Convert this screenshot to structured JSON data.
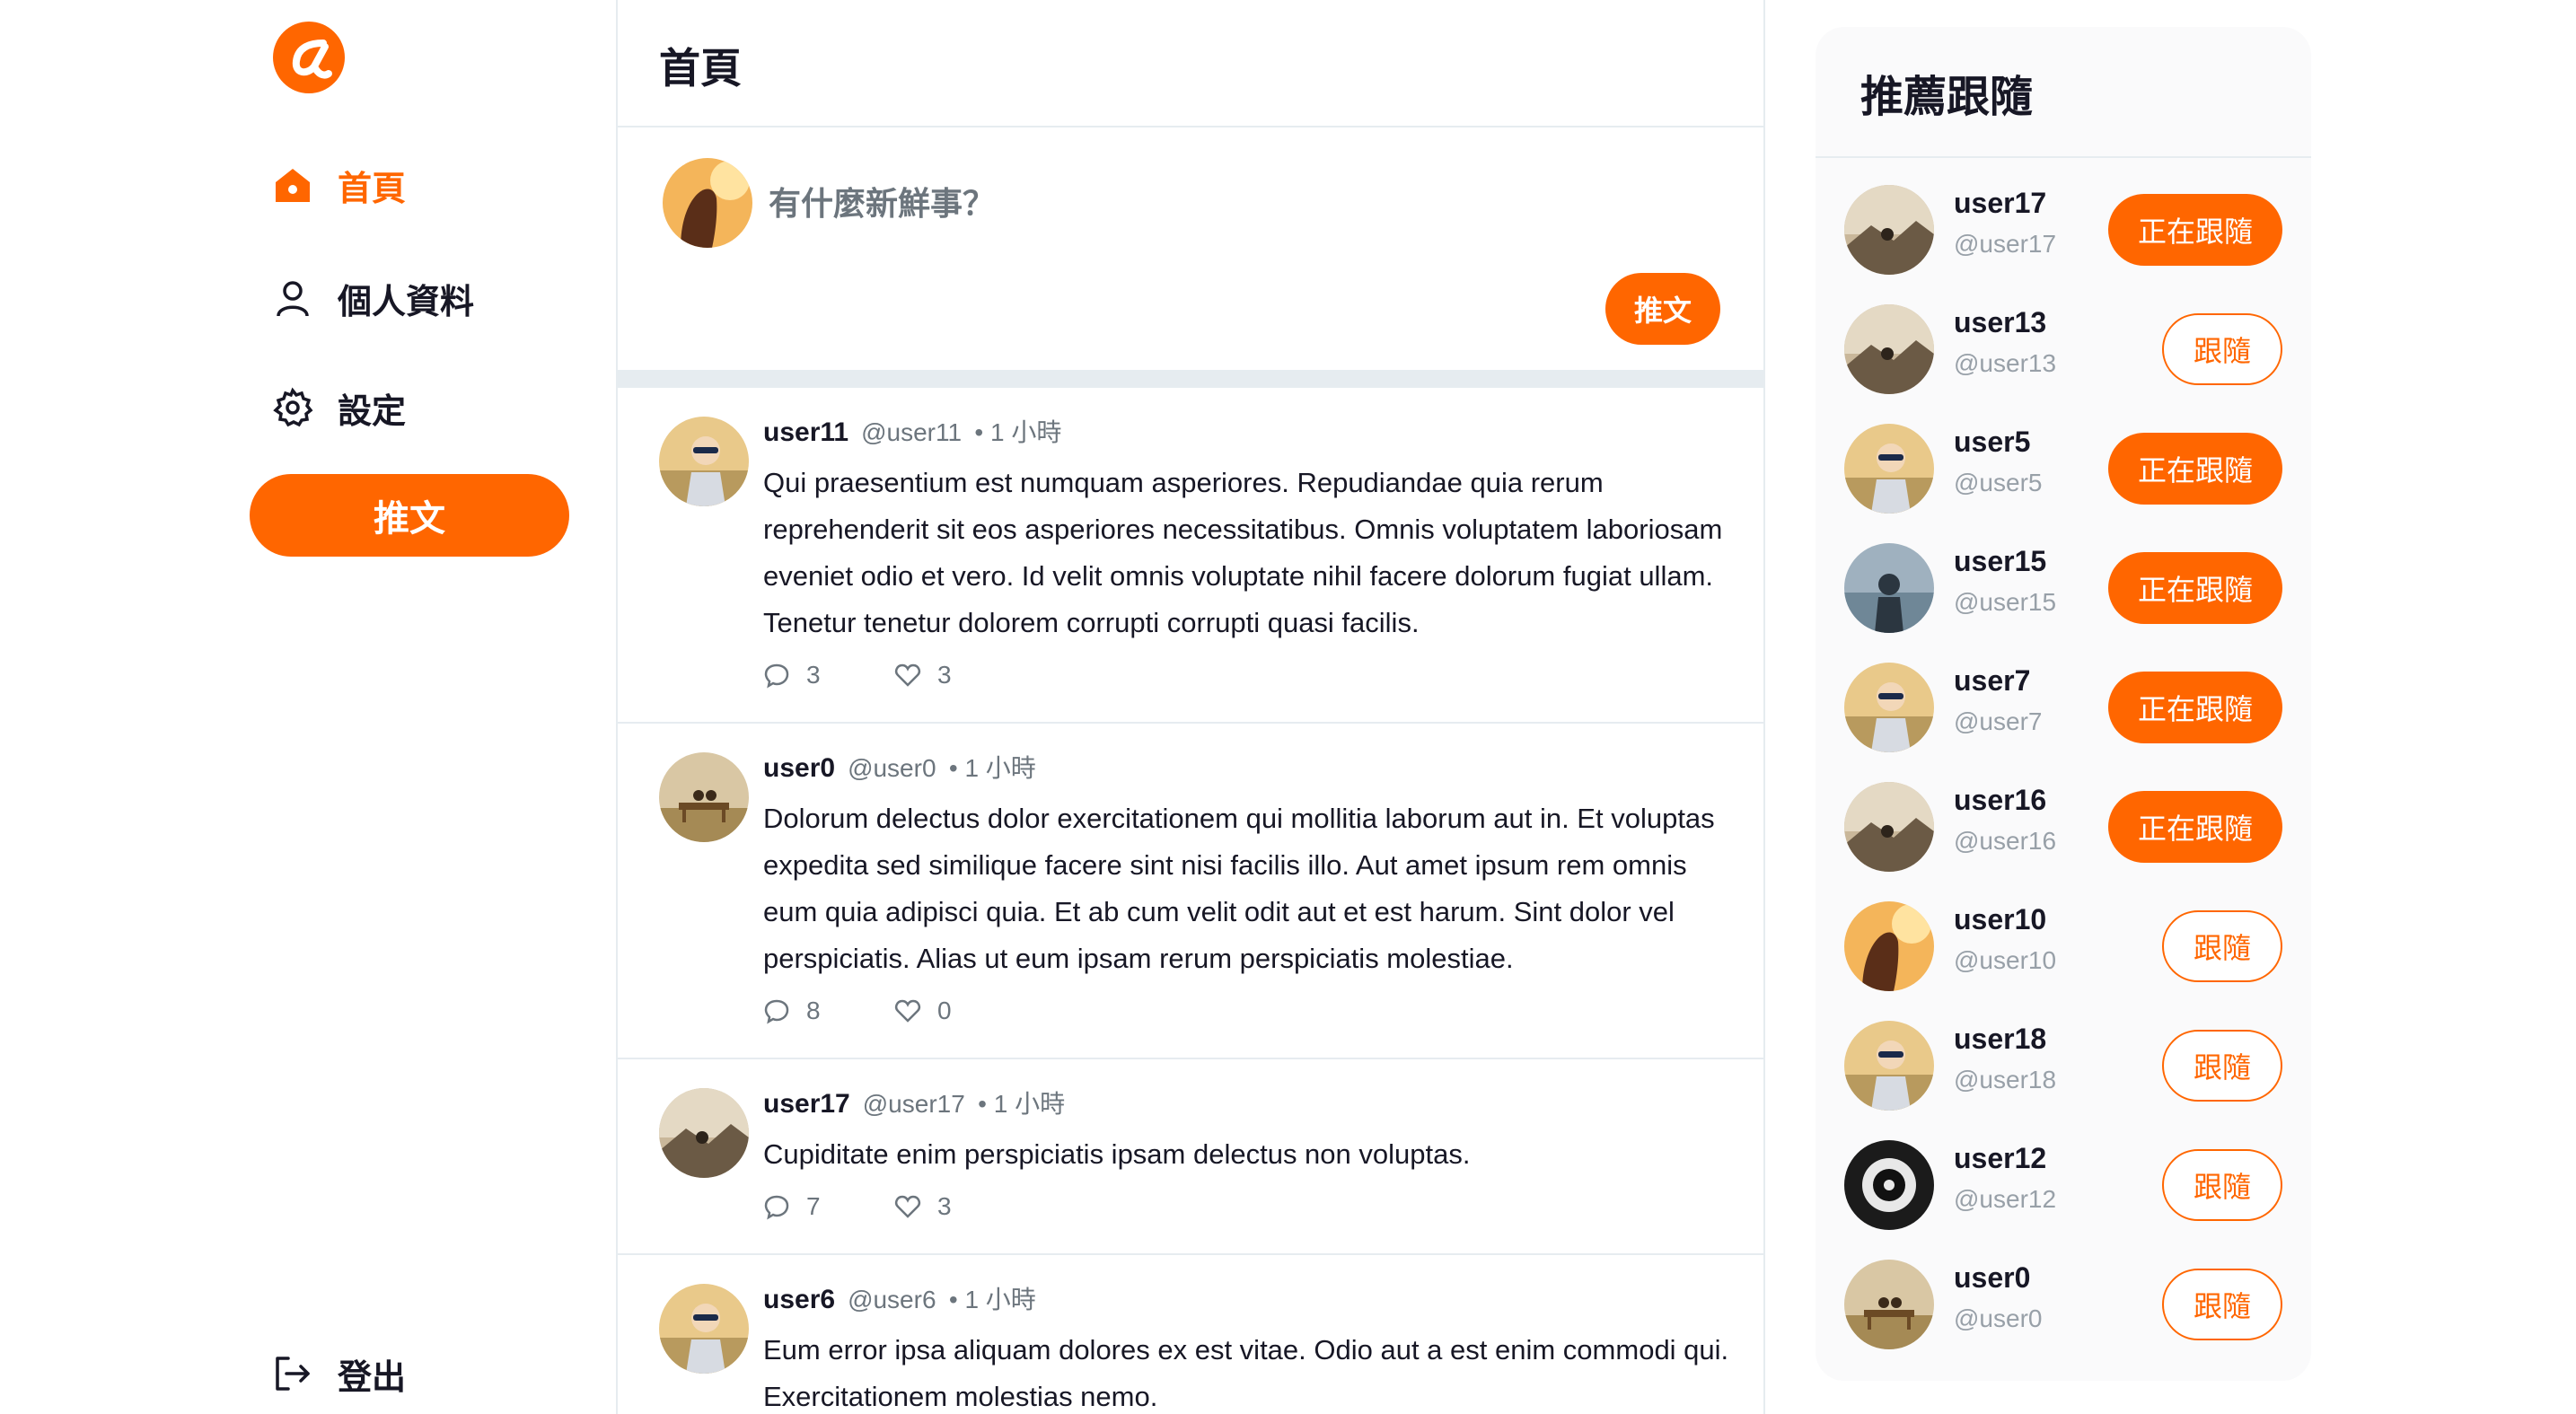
{
  "brand": {
    "accent": "#ff6600",
    "text": "#171725",
    "muted": "#6c757d",
    "logo_icon": "alpha-logo-icon"
  },
  "sidebar": {
    "nav": [
      {
        "label": "首頁",
        "icon": "home-icon",
        "active": true
      },
      {
        "label": "個人資料",
        "icon": "user-icon",
        "active": false
      },
      {
        "label": "設定",
        "icon": "gear-icon",
        "active": false
      }
    ],
    "tweet_button": "推文",
    "logout": {
      "label": "登出",
      "icon": "logout-icon"
    }
  },
  "main": {
    "title": "首頁",
    "compose": {
      "placeholder": "有什麼新鮮事？",
      "button": "推文"
    },
    "tweets": [
      {
        "name": "user11",
        "handle": "@user11",
        "time": "• 1 小時",
        "body": "Qui praesentium est numquam asperiores. Repudiandae quia rerum reprehenderit sit eos asperiores necessitatibus. Omnis voluptatem laboriosam eveniet odio et vero. Id velit omnis voluptate nihil facere dolorum fugiat ullam. Tenetur tenetur dolorem corrupti corrupti quasi facilis.",
        "replies": "3",
        "likes": "3"
      },
      {
        "name": "user0",
        "handle": "@user0",
        "time": "• 1 小時",
        "body": "Dolorum delectus dolor exercitationem qui mollitia laborum aut in. Et voluptas expedita sed similique facere sint nisi facilis illo. Aut amet ipsum rem omnis eum quia adipisci quia. Et ab cum velit odit aut et est harum. Sint dolor vel perspiciatis. Alias ut eum ipsam rerum perspiciatis molestiae.",
        "replies": "8",
        "likes": "0"
      },
      {
        "name": "user17",
        "handle": "@user17",
        "time": "• 1 小時",
        "body": "Cupiditate enim perspiciatis ipsam delectus non voluptas.",
        "replies": "7",
        "likes": "3"
      },
      {
        "name": "user6",
        "handle": "@user6",
        "time": "• 1 小時",
        "body": "Eum error ipsa aliquam dolores ex est vitae. Odio aut a est enim commodi qui. Exercitationem molestias nemo.",
        "replies": "",
        "likes": ""
      }
    ]
  },
  "recommend": {
    "title": "推薦跟隨",
    "users": [
      {
        "name": "user17",
        "handle": "@user17",
        "button": "正在跟隨",
        "following": true
      },
      {
        "name": "user13",
        "handle": "@user13",
        "button": "跟隨",
        "following": false
      },
      {
        "name": "user5",
        "handle": "@user5",
        "button": "正在跟隨",
        "following": true
      },
      {
        "name": "user15",
        "handle": "@user15",
        "button": "正在跟隨",
        "following": true
      },
      {
        "name": "user7",
        "handle": "@user7",
        "button": "正在跟隨",
        "following": true
      },
      {
        "name": "user16",
        "handle": "@user16",
        "button": "正在跟隨",
        "following": true
      },
      {
        "name": "user10",
        "handle": "@user10",
        "button": "跟隨",
        "following": false
      },
      {
        "name": "user18",
        "handle": "@user18",
        "button": "跟隨",
        "following": false
      },
      {
        "name": "user12",
        "handle": "@user12",
        "button": "跟隨",
        "following": false
      },
      {
        "name": "user0",
        "handle": "@user0",
        "button": "跟隨",
        "following": false
      }
    ]
  }
}
